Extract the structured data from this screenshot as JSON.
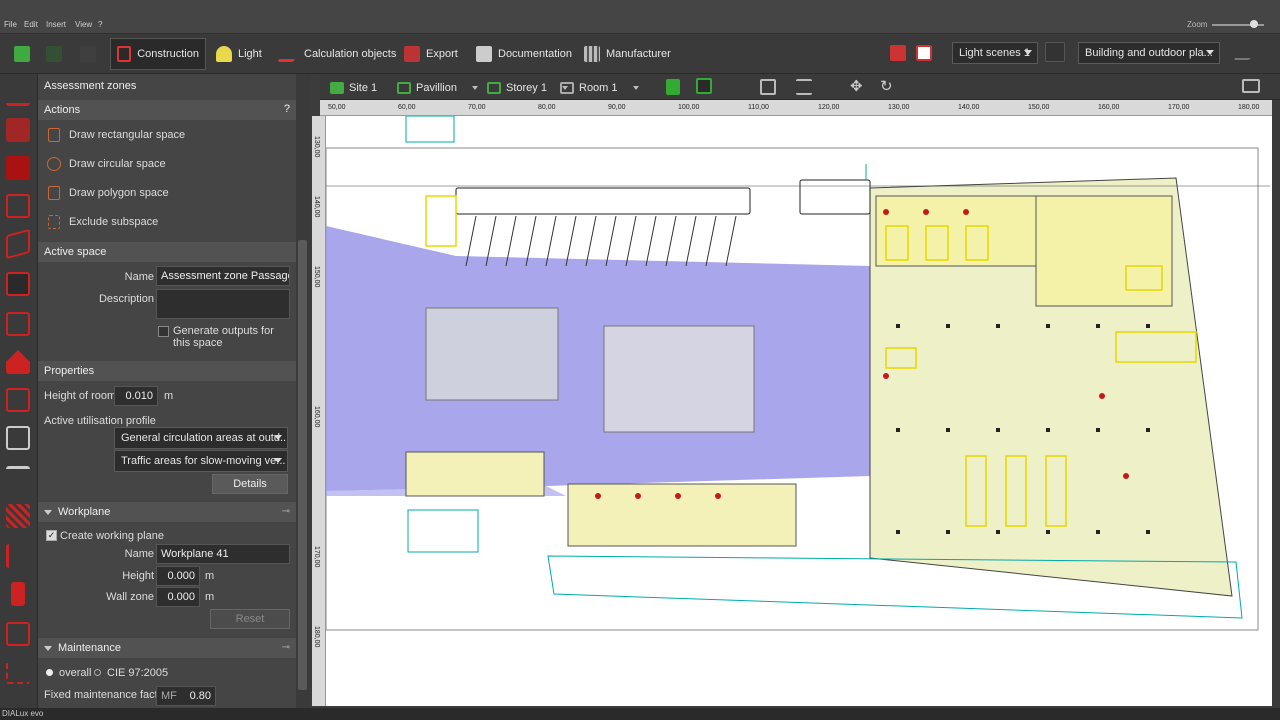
{
  "menubar": {
    "items": [
      "File",
      "Edit",
      "Insert",
      "View",
      "?"
    ],
    "zoom_label": "Zoom"
  },
  "toolbar": {
    "tabs": [
      "Construction",
      "Light",
      "Calculation objects",
      "Export",
      "Documentation",
      "Manufacturer"
    ],
    "light_scenes": "Light scenes 1",
    "building_dropdown": "Building and outdoor pla..."
  },
  "panel": {
    "title": "Assessment zones",
    "actions_header": "Actions",
    "help": "?",
    "actions": [
      "Draw rectangular space",
      "Draw circular space",
      "Draw polygon space",
      "Exclude subspace"
    ],
    "active_space": {
      "header": "Active space",
      "name_label": "Name",
      "name_value": "Assessment zone Passage",
      "description_label": "Description",
      "description_value": "",
      "generate_outputs": "Generate outputs for this space"
    },
    "properties": {
      "header": "Properties",
      "height_label": "Height of room",
      "height_value": "0.010",
      "height_unit": "m",
      "profile_label": "Active utilisation profile",
      "profile_1": "General circulation areas at outd...",
      "profile_2": "Traffic areas for slow-moving ve...",
      "details": "Details"
    },
    "workplane": {
      "header": "Workplane",
      "create": "Create working plane",
      "name_label": "Name",
      "name_value": "Workplane 41",
      "height_label": "Height",
      "height_value": "0.000",
      "height_unit": "m",
      "wall_label": "Wall zone",
      "wall_value": "0.000",
      "wall_unit": "m",
      "reset": "Reset"
    },
    "maintenance": {
      "header": "Maintenance",
      "overall": "overall",
      "cie": "CIE 97:2005",
      "factor_label": "Fixed maintenance factor",
      "mf_label": "MF",
      "mf_value": "0.80"
    }
  },
  "viewbar": {
    "site": "Site 1",
    "building": "Pavillion",
    "storey": "Storey 1",
    "room": "Room 1"
  },
  "ruler": {
    "ticks": [
      "50,00",
      "60,00",
      "70,00",
      "80,00",
      "90,00",
      "100,00",
      "110,00",
      "120,00",
      "130,00",
      "140,00",
      "150,00",
      "160,00",
      "170,00",
      "180,00"
    ]
  },
  "vruler": {
    "ticks": [
      "130,00",
      "140,00",
      "150,00",
      "160,00",
      "170,00",
      "180,00"
    ]
  },
  "statusbar": {
    "text": "DIALux evo"
  },
  "colors": {
    "zone_fill": "#9a97e8",
    "room_fill": "#eef0c8",
    "accent_red": "#c41a1a",
    "active_tab": "#2a2a2a"
  }
}
